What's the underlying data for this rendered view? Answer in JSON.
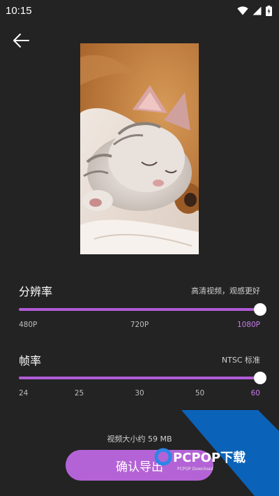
{
  "status_bar": {
    "time": "10:15"
  },
  "header": {
    "back_icon": "arrow-left-icon"
  },
  "resolution": {
    "title": "分辨率",
    "description": "高清视频，观感更好",
    "value_fraction": 1.0,
    "ticks": [
      "480P",
      "720P",
      "1080P"
    ],
    "selected": "1080P"
  },
  "framerate": {
    "title": "帧率",
    "description": "NTSC 标准",
    "value_fraction": 1.0,
    "ticks": [
      "24",
      "25",
      "30",
      "50",
      "60"
    ],
    "selected": "60"
  },
  "footer": {
    "size_text": "视频大小约 59 MB",
    "export_label": "确认导出"
  },
  "watermark": {
    "brand": "PCPOP下载",
    "sub": "PCPOP Download"
  },
  "colors": {
    "background": "#232323",
    "accent": "#b15bd8",
    "button": "#b463d6"
  }
}
